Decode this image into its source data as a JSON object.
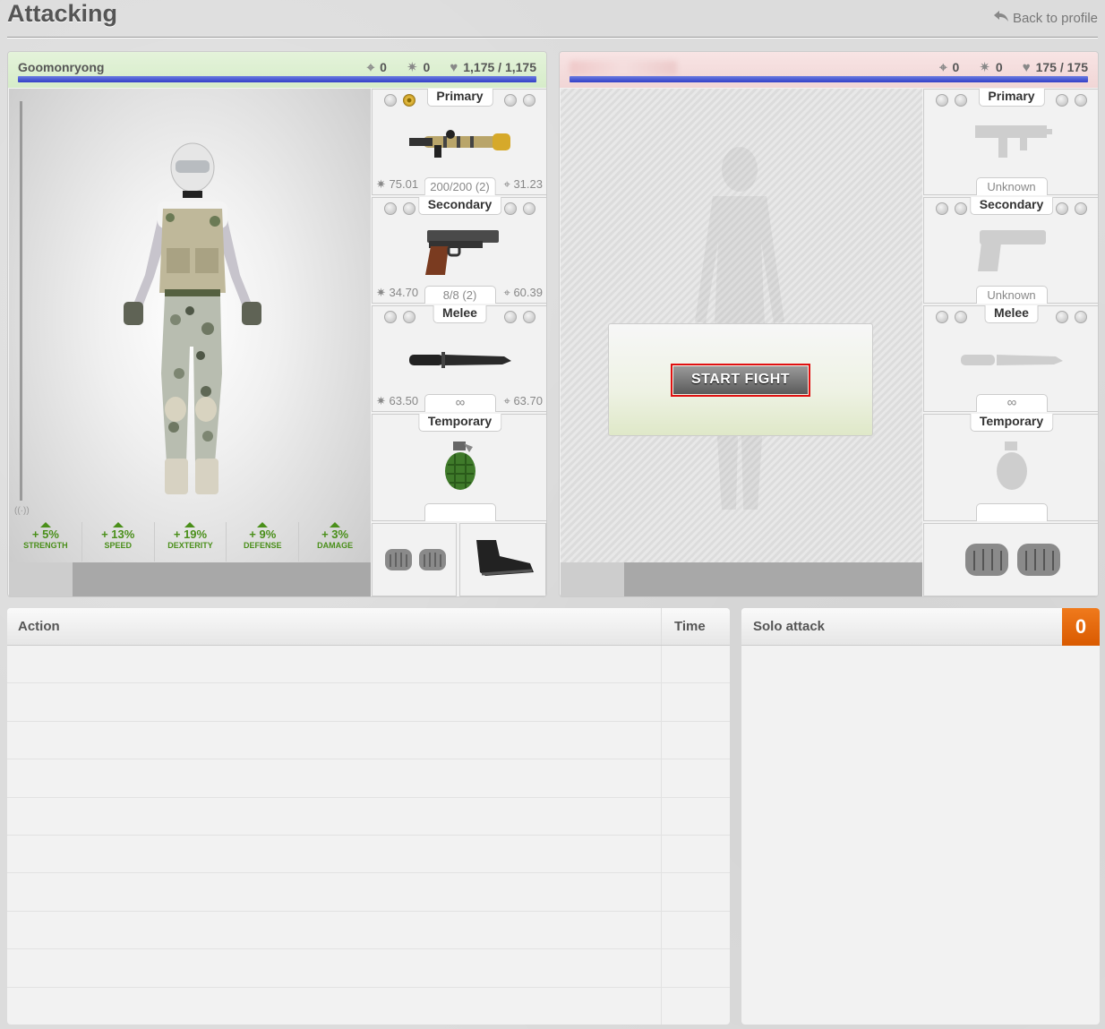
{
  "page": {
    "title": "Attacking",
    "back_label": "Back to profile"
  },
  "attacker": {
    "name": "Goomonryong",
    "stat1": "0",
    "stat2": "0",
    "life": "1,175 / 1,175",
    "mods": [
      {
        "value": "+ 5%",
        "label": "STRENGTH"
      },
      {
        "value": "+ 13%",
        "label": "SPEED"
      },
      {
        "value": "+ 19%",
        "label": "DEXTERITY"
      },
      {
        "value": "+ 9%",
        "label": "DEFENSE"
      },
      {
        "value": "+ 3%",
        "label": "DAMAGE"
      }
    ],
    "slots": {
      "primary": {
        "label": "Primary",
        "dmg": "75.01",
        "ammo": "200/200 (2)",
        "acc": "31.23"
      },
      "secondary": {
        "label": "Secondary",
        "dmg": "34.70",
        "ammo": "8/8 (2)",
        "acc": "60.39"
      },
      "melee": {
        "label": "Melee",
        "dmg": "63.50",
        "ammo": "∞",
        "acc": "63.70"
      },
      "temporary": {
        "label": "Temporary"
      }
    }
  },
  "defender": {
    "stat1": "0",
    "stat2": "0",
    "life": "175 / 175",
    "start_label": "START FIGHT",
    "slots": {
      "primary": {
        "label": "Primary",
        "ammo": "Unknown"
      },
      "secondary": {
        "label": "Secondary",
        "ammo": "Unknown"
      },
      "melee": {
        "label": "Melee",
        "ammo": "∞"
      },
      "temporary": {
        "label": "Temporary"
      }
    }
  },
  "log": {
    "col_action": "Action",
    "col_time": "Time"
  },
  "side": {
    "title": "Solo attack",
    "count": "0"
  },
  "colors": {
    "accent_orange": "#e0640a",
    "life_bar": "#3f4fd0",
    "mod_green": "#4a8f1a"
  }
}
